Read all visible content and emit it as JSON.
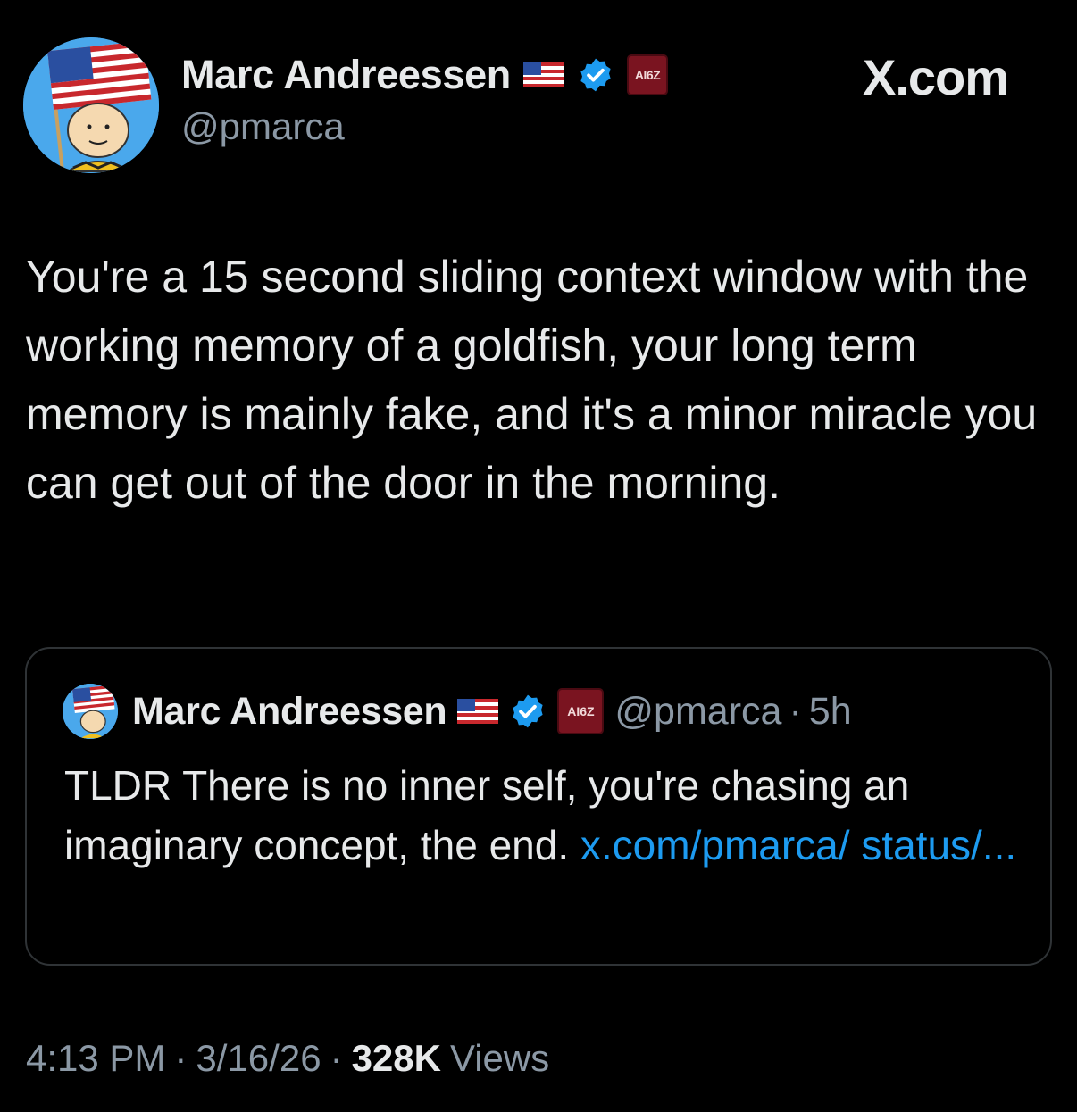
{
  "author": {
    "display_name": "Marc Andreessen",
    "handle": "@pmarca",
    "avatar_icon": "charlie-brown-with-flag-avatar",
    "flag_icon": "us-flag-icon",
    "verified_icon": "verified-badge-icon",
    "affiliation_badge": "AI6Z"
  },
  "brand": {
    "label": "X.com"
  },
  "tweet": {
    "text": "You're a 15 second sliding context window with the working memory of a goldfish, your long term memory is mainly fake, and it's a minor miracle you can get out of the door in the morning."
  },
  "quote": {
    "display_name": "Marc Andreessen",
    "handle": "@pmarca",
    "separator": "·",
    "time": "5h",
    "affiliation_badge": "AI6Z",
    "text": "TLDR There is no inner self, you're chasing an imaginary concept, the end.",
    "link_text": "x.com/pmarca/ status/..."
  },
  "meta": {
    "time": "4:13 PM",
    "separator": "·",
    "date": "3/16/26",
    "views_count": "328K",
    "views_label": "Views"
  },
  "colors": {
    "background": "#000000",
    "text_primary": "#e7e9ea",
    "text_secondary": "#8b98a5",
    "link": "#1d9bf0",
    "verified": "#1d9bf0",
    "badge_bg": "#7a1420"
  }
}
